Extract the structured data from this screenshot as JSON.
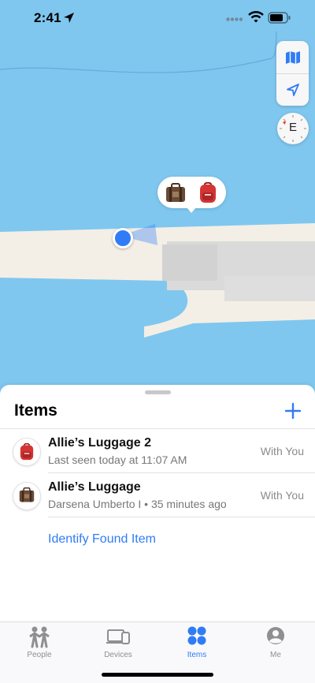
{
  "status_bar": {
    "time": "2:41"
  },
  "map": {
    "compass_heading": "E",
    "colors": {
      "water": "#7fc7ef",
      "land": "#f3efe6",
      "buildings": "#dcdcdc",
      "user_dot": "#2f7cf6"
    }
  },
  "sheet": {
    "title": "Items",
    "items": [
      {
        "name": "Allie’s Luggage 2",
        "subtitle": "Last seen today at 11:07 AM",
        "status": "With You",
        "icon": "backpack-icon"
      },
      {
        "name": "Allie’s Luggage",
        "subtitle": "Darsena Umberto I • 35 minutes ago",
        "status": "With You",
        "icon": "suitcase-icon"
      }
    ],
    "identify_label": "Identify Found Item"
  },
  "tabs": [
    {
      "label": "People",
      "icon": "people-icon",
      "active": false
    },
    {
      "label": "Devices",
      "icon": "devices-icon",
      "active": false
    },
    {
      "label": "Items",
      "icon": "items-icon",
      "active": true
    },
    {
      "label": "Me",
      "icon": "person-icon",
      "active": false
    }
  ],
  "accent_color": "#2f7cf6"
}
